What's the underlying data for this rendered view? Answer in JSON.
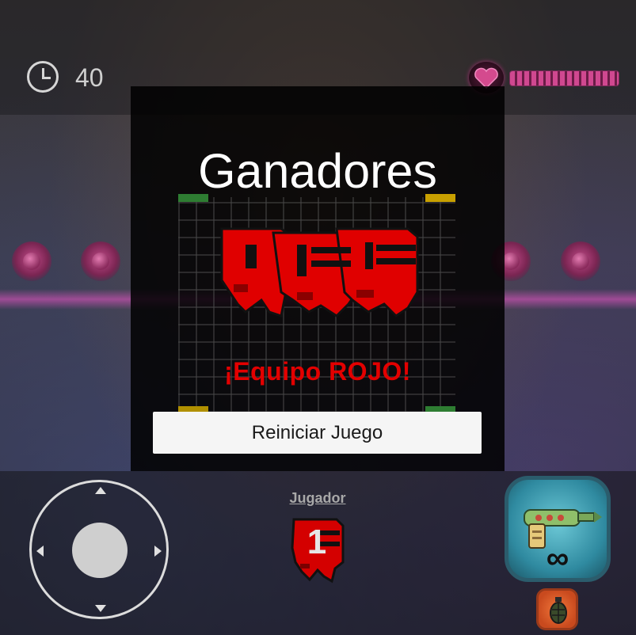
{
  "hud": {
    "timer_icon": "clock-icon",
    "timer_value": "40",
    "health_icon": "heart-icon",
    "health_fraction": 1.0
  },
  "modal": {
    "title": "Ganadores",
    "winner_icon": "red-team-creatures",
    "team_text": "¡Equipo ROJO!",
    "restart_label": "Reiniciar Juego"
  },
  "player": {
    "label": "Jugador",
    "number": "1",
    "team_color": "#e00000"
  },
  "controls": {
    "joystick": "virtual-joystick",
    "weapon_icon": "ray-gun-icon",
    "ammo": "∞",
    "secondary_icon": "grenade-icon"
  },
  "colors": {
    "accent_red": "#e30000",
    "health_pink": "#d04890",
    "weapon_teal": "#2f8aa0"
  }
}
